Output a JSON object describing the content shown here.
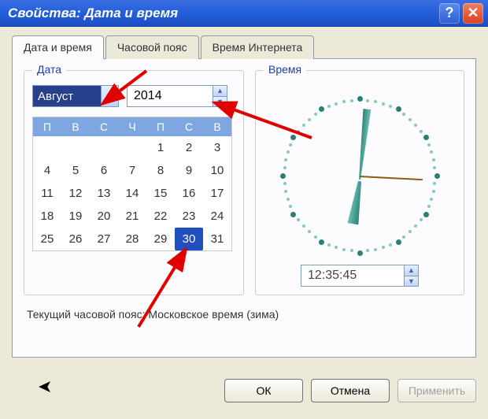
{
  "window": {
    "title": "Свойства: Дата и время"
  },
  "tabs": {
    "t0": "Дата и время",
    "t1": "Часовой пояс",
    "t2": "Время Интернета"
  },
  "date_group": {
    "legend": "Дата",
    "month_selected": "Август",
    "year": "2014",
    "weekdays": {
      "d0": "П",
      "d1": "В",
      "d2": "С",
      "d3": "Ч",
      "d4": "П",
      "d5": "С",
      "d6": "В"
    },
    "grid": [
      [
        "",
        "",
        "",
        "",
        "1",
        "2",
        "3"
      ],
      [
        "4",
        "5",
        "6",
        "7",
        "8",
        "9",
        "10"
      ],
      [
        "11",
        "12",
        "13",
        "14",
        "15",
        "16",
        "17"
      ],
      [
        "18",
        "19",
        "20",
        "21",
        "22",
        "23",
        "24"
      ],
      [
        "25",
        "26",
        "27",
        "28",
        "29",
        "30",
        "31"
      ]
    ],
    "selected_day": "30"
  },
  "time_group": {
    "legend": "Время",
    "time_value": "12:35:45"
  },
  "timezone_line": "Текущий часовой пояс: Московское время (зима)",
  "buttons": {
    "ok": "ОК",
    "cancel": "Отмена",
    "apply": "Применить"
  }
}
